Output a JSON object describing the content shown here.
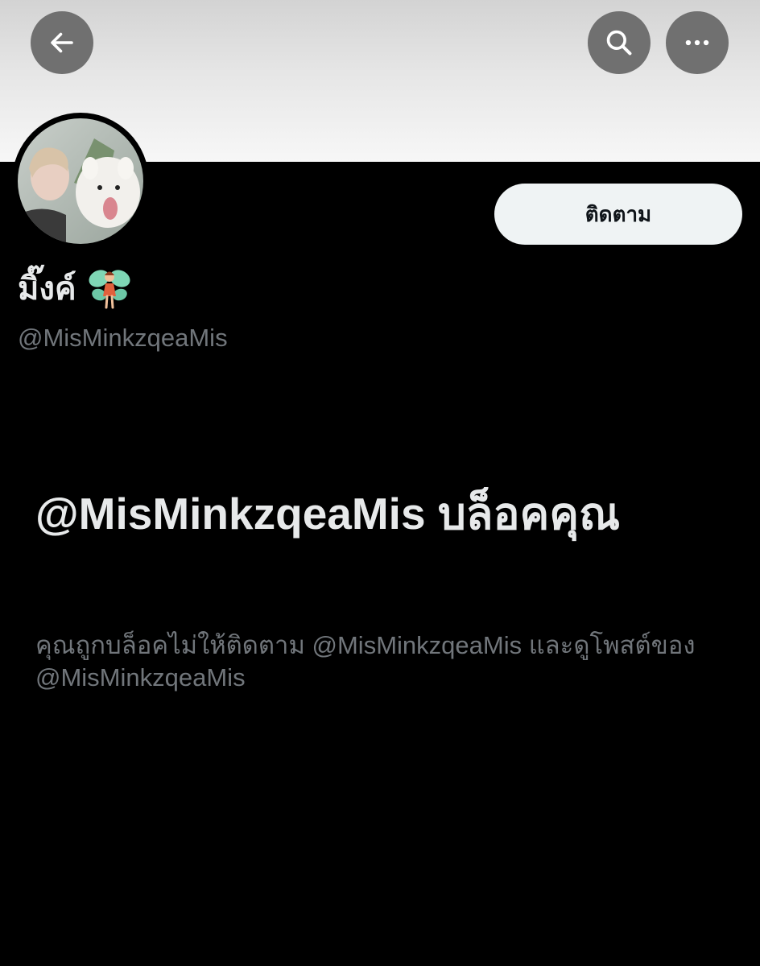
{
  "header": {
    "back_icon": "arrow-left-icon",
    "search_icon": "search-icon",
    "more_icon": "more-horizontal-icon",
    "button_color": "#707070"
  },
  "profile": {
    "display_name": "มิ๊งค์",
    "name_emoji_icon": "fairy-icon",
    "handle": "@MisMinkzqeaMis",
    "follow_label": "ติดตาม"
  },
  "blocked": {
    "title": "@MisMinkzqeaMis บล็อคคุณ",
    "description": "คุณถูกบล็อคไม่ให้ติดตาม @MisMinkzqeaMis และดูโพสต์ของ @MisMinkzqeaMis"
  },
  "colors": {
    "background": "#000000",
    "primary_text": "#e7e9ea",
    "secondary_text": "#71767b",
    "follow_button_bg": "#eff3f4"
  }
}
